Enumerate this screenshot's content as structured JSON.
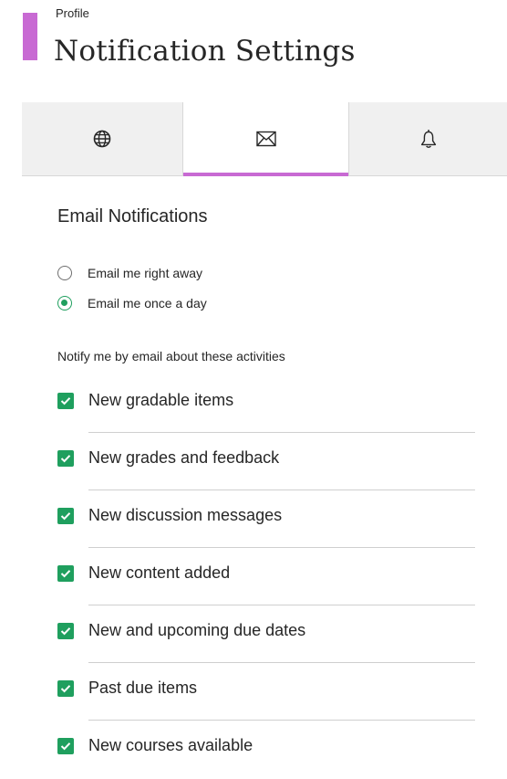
{
  "header": {
    "breadcrumb": "Profile",
    "title": "Notification Settings",
    "accent_color": "#c86ad3"
  },
  "tabs": [
    {
      "icon": "globe-icon",
      "selected": false
    },
    {
      "icon": "envelope-icon",
      "selected": true
    },
    {
      "icon": "bell-icon",
      "selected": false
    }
  ],
  "email": {
    "title": "Email Notifications",
    "frequency": {
      "options": [
        {
          "label": "Email me right away",
          "selected": false
        },
        {
          "label": "Email me once a day",
          "selected": true
        }
      ]
    },
    "activities_heading": "Notify me by email about these activities",
    "activities": [
      {
        "label": "New gradable items",
        "checked": true
      },
      {
        "label": "New grades and feedback",
        "checked": true
      },
      {
        "label": "New discussion messages",
        "checked": true
      },
      {
        "label": "New content added",
        "checked": true
      },
      {
        "label": "New and upcoming due dates",
        "checked": true
      },
      {
        "label": "Past due items",
        "checked": true
      },
      {
        "label": "New courses available",
        "checked": true
      }
    ]
  },
  "colors": {
    "checked_green": "#1f9f5e",
    "tab_background": "#f0f0f0"
  }
}
